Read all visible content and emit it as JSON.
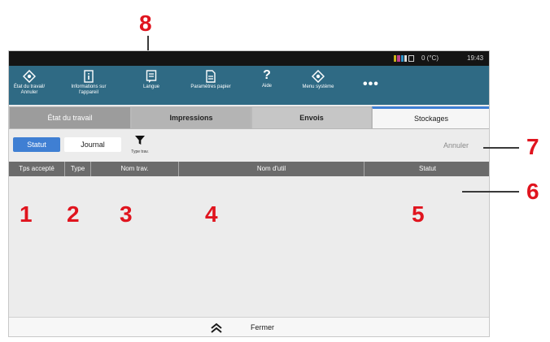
{
  "status_bar": {
    "ink_colors": [
      "#c9b21a",
      "#c23e8b",
      "#2c93c9",
      "#1a1a1a"
    ],
    "temperature": "0 (°C)",
    "time": "19:43"
  },
  "toolbar": [
    {
      "icon": "job-status-icon",
      "label": "État du travail/ Annuler"
    },
    {
      "icon": "device-info-icon",
      "label": "Informations sur l'appareil"
    },
    {
      "icon": "language-icon",
      "label": "Langue"
    },
    {
      "icon": "paper-settings-icon",
      "label": "Paramètres papier"
    },
    {
      "icon": "help-icon",
      "label": "Aide"
    },
    {
      "icon": "system-menu-icon",
      "label": "Menu système"
    },
    {
      "icon": "more-icon",
      "label": "•••"
    }
  ],
  "tabs": [
    "État du travail",
    "Impressions",
    "Envois",
    "Stockages"
  ],
  "active_tab": "Stockages",
  "subbar": {
    "status_button": "Statut",
    "log_button": "Journal",
    "filter_label": "Type trav.",
    "cancel": "Annuler"
  },
  "columns": [
    "Tps accepté",
    "Type",
    "Nom trav.",
    "Nom d'util",
    "Statut"
  ],
  "footer": {
    "close": "Fermer"
  },
  "callouts": [
    "1",
    "2",
    "3",
    "4",
    "5",
    "6",
    "7",
    "8"
  ],
  "colors": {
    "accent": "#3f7fd3",
    "toolbar": "#2f6a84",
    "callout": "#e0141e"
  }
}
